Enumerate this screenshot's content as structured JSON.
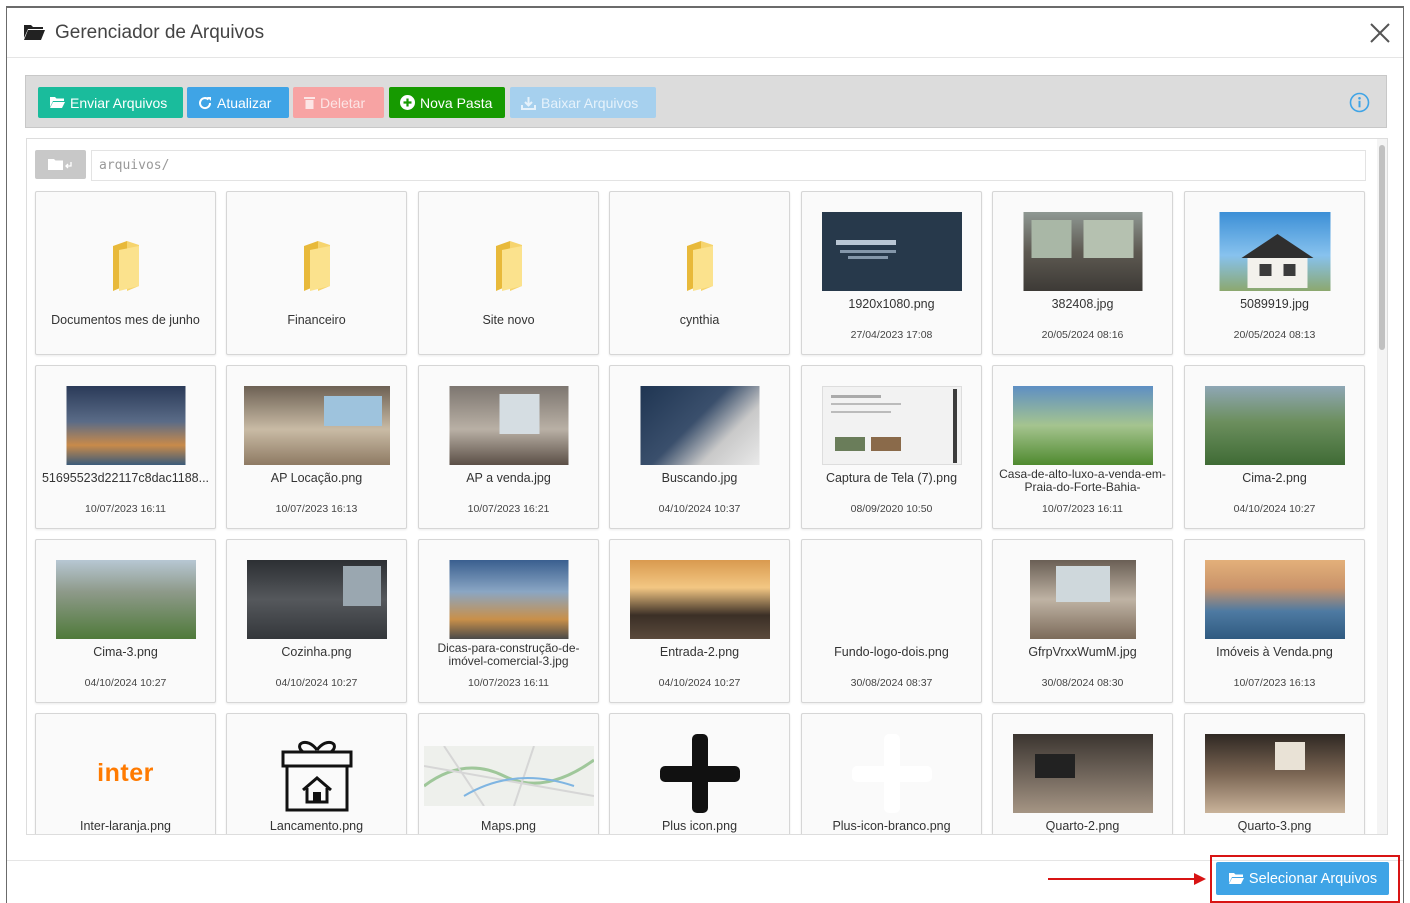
{
  "modal": {
    "title": "Gerenciador de Arquivos",
    "close_icon": "close-icon"
  },
  "toolbar": {
    "enviar": "Enviar Arquivos",
    "atualizar": "Atualizar",
    "deletar": "Deletar",
    "nova_pasta": "Nova Pasta",
    "baixar": "Baixar Arquivos"
  },
  "path": {
    "value": "arquivos/"
  },
  "files": [
    {
      "name": "Documentos mes de junho",
      "date": "",
      "kind": "folder"
    },
    {
      "name": "Financeiro",
      "date": "",
      "kind": "folder"
    },
    {
      "name": "Site novo",
      "date": "",
      "kind": "folder"
    },
    {
      "name": "cynthia",
      "date": "",
      "kind": "folder"
    },
    {
      "name": "1920x1080.png",
      "date": "27/04/2023 17:08",
      "kind": "image"
    },
    {
      "name": "382408.jpg",
      "date": "20/05/2024 08:16",
      "kind": "image"
    },
    {
      "name": "5089919.jpg",
      "date": "20/05/2024 08:13",
      "kind": "image"
    },
    {
      "name": "51695523d22117c8dac1188...",
      "date": "10/07/2023 16:11",
      "kind": "image"
    },
    {
      "name": "AP Locação.png",
      "date": "10/07/2023 16:13",
      "kind": "image"
    },
    {
      "name": "AP a venda.jpg",
      "date": "10/07/2023 16:21",
      "kind": "image"
    },
    {
      "name": "Buscando.jpg",
      "date": "04/10/2024 10:37",
      "kind": "image"
    },
    {
      "name": "Captura de Tela (7).png",
      "date": "08/09/2020 10:50",
      "kind": "image"
    },
    {
      "name": "Casa-de-alto-luxo-a-venda-em-Praia-do-Forte-Bahia-",
      "date": "10/07/2023 16:11",
      "kind": "image"
    },
    {
      "name": "Cima-2.png",
      "date": "04/10/2024 10:27",
      "kind": "image"
    },
    {
      "name": "Cima-3.png",
      "date": "04/10/2024 10:27",
      "kind": "image"
    },
    {
      "name": "Cozinha.png",
      "date": "04/10/2024 10:27",
      "kind": "image"
    },
    {
      "name": "Dicas-para-construção-de-imóvel-comercial-3.jpg",
      "date": "10/07/2023 16:11",
      "kind": "image"
    },
    {
      "name": "Entrada-2.png",
      "date": "04/10/2024 10:27",
      "kind": "image"
    },
    {
      "name": "Fundo-logo-dois.png",
      "date": "30/08/2024 08:37",
      "kind": "image"
    },
    {
      "name": "GfrpVrxxWumM.jpg",
      "date": "30/08/2024 08:30",
      "kind": "image"
    },
    {
      "name": "Imóveis à Venda.png",
      "date": "10/07/2023 16:13",
      "kind": "image"
    },
    {
      "name": "Inter-laranja.png",
      "date": "",
      "kind": "image"
    },
    {
      "name": "Lancamento.png",
      "date": "",
      "kind": "image"
    },
    {
      "name": "Maps.png",
      "date": "",
      "kind": "image"
    },
    {
      "name": "Plus icon.png",
      "date": "",
      "kind": "image"
    },
    {
      "name": "Plus-icon-branco.png",
      "date": "",
      "kind": "image"
    },
    {
      "name": "Quarto-2.png",
      "date": "",
      "kind": "image"
    },
    {
      "name": "Quarto-3.png",
      "date": "",
      "kind": "image"
    }
  ],
  "thumb_text": {
    "inter_logo": "inter"
  },
  "footer": {
    "select_button": "Selecionar Arquivos"
  },
  "colors": {
    "teal": "#1abc9c",
    "blue": "#3fa4e6",
    "green": "#169a00",
    "red_highlight": "#d81414"
  }
}
